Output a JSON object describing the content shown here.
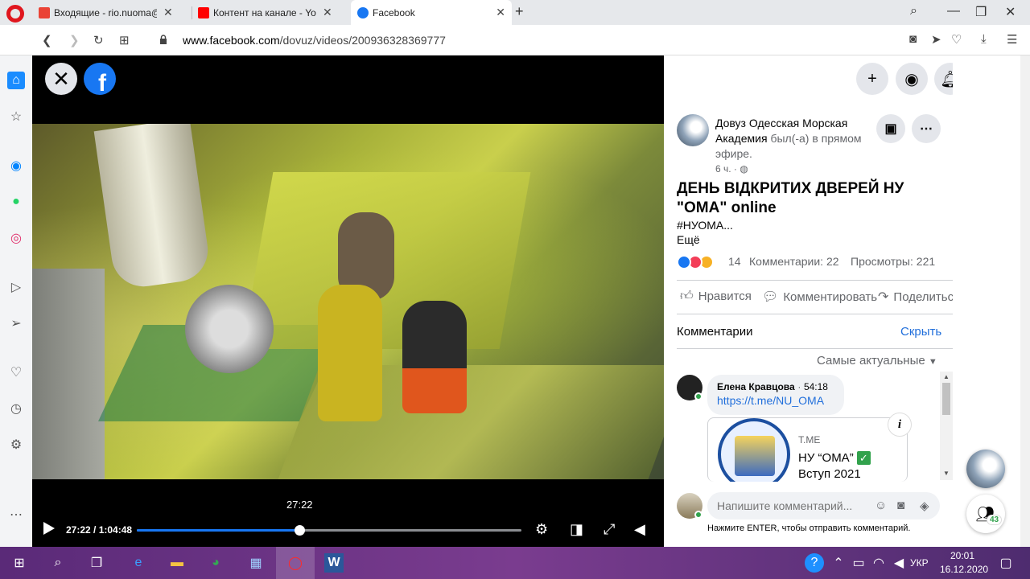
{
  "tabs": [
    {
      "label": "Входящие - rio.nuoma@gm",
      "color": "#ea4335"
    },
    {
      "label": "Контент на канале - YouTube",
      "color": "#ff0000"
    },
    {
      "label": "Facebook",
      "color": "#1877f2"
    }
  ],
  "address": {
    "host": "www.facebook.com",
    "path": "/dovuz/videos/200936328369777"
  },
  "video": {
    "timestamp_popup": "27:22",
    "time_display": "27:22 / 1:04:48",
    "progress": 0.4227
  },
  "post": {
    "page_name": "Довуз Одесская Морская Академия",
    "live_text": "был(-а) в прямом эфире.",
    "time_ago": "6 ч. ·",
    "title": "ДЕНЬ ВІДКРИТИХ ДВЕРЕЙ НУ \"ОМА\" online",
    "hashtag": "#НУОМА...",
    "more": "Ещё",
    "reactions_count": "14",
    "comments_count": "Комментарии: 22",
    "views_count": "Просмотры: 221"
  },
  "actions": {
    "like": "Нравится",
    "comment": "Комментировать",
    "share": "Поделиться"
  },
  "comments": {
    "header": "Комментарии",
    "hide": "Скрыть",
    "sort": "Самые актуальные",
    "items": [
      {
        "author": "Елена Кравцова",
        "time": "54:18",
        "link": "https://t.me/NU_OMA",
        "preview_site": "T.ME",
        "preview_title_1": "НУ “ОМА”",
        "preview_title_2": "Вступ 2021"
      }
    ],
    "input_placeholder": "Напишите комментарий...",
    "hint": "Нажмите ENTER, чтобы отправить комментарий."
  },
  "contacts_badge": "43",
  "tray": {
    "lang": "УКР",
    "time": "20:01",
    "date": "16.12.2020"
  },
  "colors": {
    "facebook_blue": "#1877f2",
    "link": "#216fdb",
    "online": "#31a24c"
  }
}
